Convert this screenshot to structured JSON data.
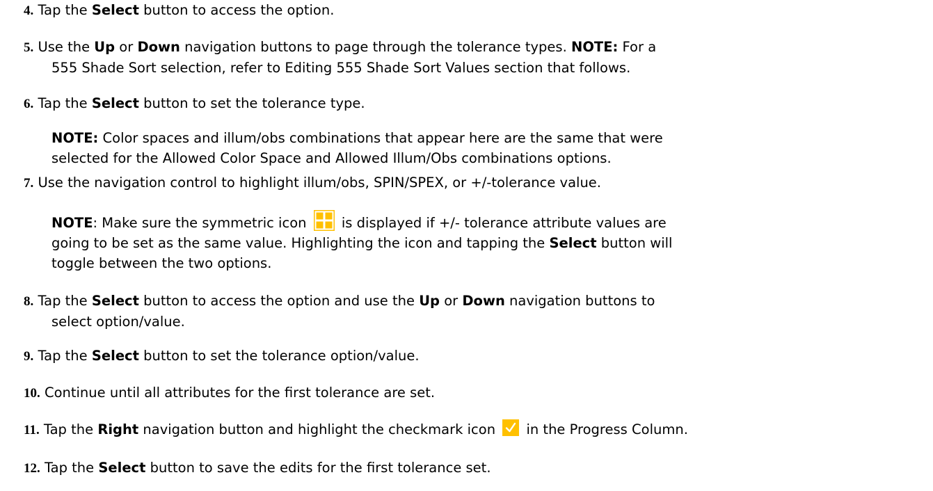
{
  "steps": [
    {
      "num": "4.",
      "p1": "Tap the ",
      "b1": "Select",
      "p2": " button to access the option."
    },
    {
      "num": "5.",
      "p1": "Use the ",
      "b1": "Up",
      "p2": " or ",
      "b2": "Down",
      "p3": " navigation buttons to page through the tolerance types. ",
      "b3": "NOTE:",
      "p4": " For a",
      "l2": "555 Shade Sort selection, refer to Editing 555 Shade Sort Values section that follows."
    },
    {
      "num": "6.",
      "p1": "Tap the ",
      "b1": "Select",
      "p2": " button to set the tolerance type."
    },
    {
      "num": "7.",
      "p1": "Use the navigation control to highlight illum/obs, SPIN/SPEX, or +/-tolerance value."
    },
    {
      "num": "8.",
      "p1": "Tap the ",
      "b1": "Select",
      "p2": " button to access the option and use the ",
      "b2": "Up",
      "p3": " or ",
      "b3": "Down",
      "p4": " navigation buttons to",
      "l2": "select option/value."
    },
    {
      "num": "9.",
      "p1": "Tap the ",
      "b1": "Select",
      "p2": " button to set the tolerance option/value."
    },
    {
      "num": "10.",
      "p1": "Continue until all attributes for the first tolerance are set."
    },
    {
      "num": "11.",
      "p1": "Tap the ",
      "b1": "Right",
      "p2": " navigation button and highlight the checkmark icon ",
      "p3": " in the Progress Column."
    },
    {
      "num": "12.",
      "p1": "Tap the ",
      "b1": "Select",
      "p2": " button to save the edits for the first tolerance set."
    }
  ],
  "note_step6": {
    "label": "NOTE:",
    "l1": " Color spaces and illum/obs combinations that appear here are the same that were",
    "l2": "selected for the Allowed Color Space and Allowed Illum/Obs combinations options."
  },
  "note_step7": {
    "label": "NOTE",
    "t1": ": Make sure the symmetric icon ",
    "t2": " is displayed if +/- tolerance attribute values are",
    "l2a": "going to be set as the same value. Highlighting the icon and tapping the ",
    "l2b": "Select",
    "l2c": " button will",
    "l3": "toggle between the two options."
  },
  "icons": {
    "symmetric": "symmetric-grid-icon",
    "checkmark": "checkmark-icon",
    "color": "#FFC000"
  }
}
